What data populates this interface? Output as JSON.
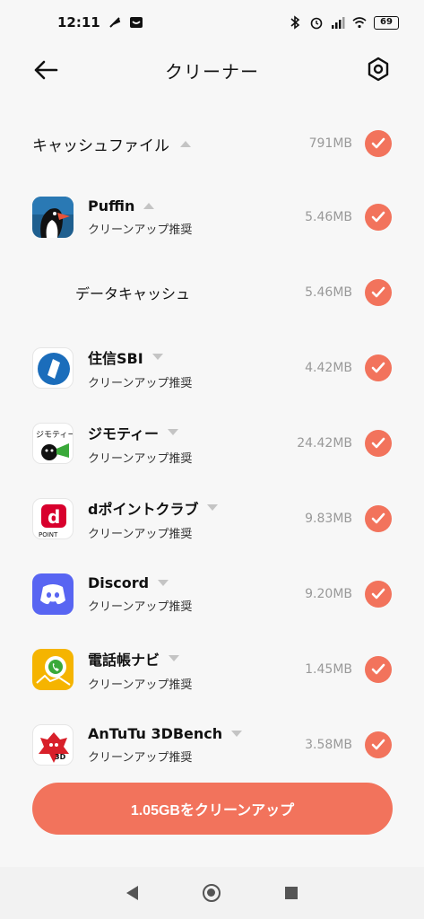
{
  "status_bar": {
    "time": "12:11",
    "battery": "69"
  },
  "header": {
    "title": "クリーナー"
  },
  "section": {
    "label": "キャッシュファイル",
    "size": "791MB"
  },
  "apps": [
    {
      "name": "Puffin",
      "sub": "クリーンアップ推奨",
      "size": "5.46MB",
      "expanded": true
    },
    {
      "name": "住信SBI",
      "sub": "クリーンアップ推奨",
      "size": "4.42MB"
    },
    {
      "name": "ジモティー",
      "sub": "クリーンアップ推奨",
      "size": "24.42MB"
    },
    {
      "name": "dポイントクラブ",
      "sub": "クリーンアップ推奨",
      "size": "9.83MB"
    },
    {
      "name": "Discord",
      "sub": "クリーンアップ推奨",
      "size": "9.20MB"
    },
    {
      "name": "電話帳ナビ",
      "sub": "クリーンアップ推奨",
      "size": "1.45MB"
    },
    {
      "name": "AnTuTu 3DBench",
      "sub": "クリーンアップ推奨",
      "size": "3.58MB"
    }
  ],
  "puffin_child": {
    "label": "データキャッシュ",
    "size": "5.46MB"
  },
  "icon_text": {
    "jimoty": "ジモティー",
    "dpoint": "POINT",
    "antutu": "3D"
  },
  "clean_button": {
    "label": "1.05GBをクリーンアップ"
  },
  "colors": {
    "accent": "#f2735c"
  }
}
